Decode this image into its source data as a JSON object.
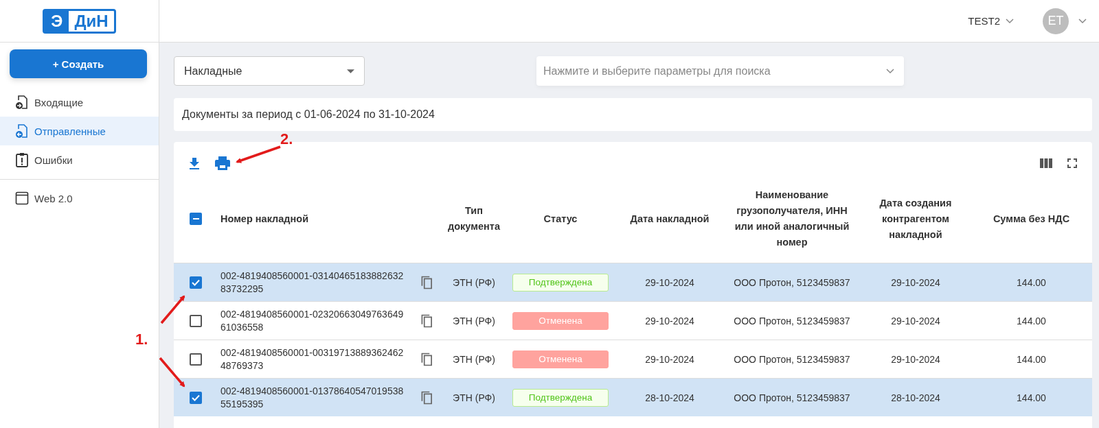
{
  "header": {
    "logo": {
      "left": "Э",
      "right": "ДиН"
    },
    "account": "TEST2",
    "avatar": "ET"
  },
  "sidebar": {
    "create_button": "+ Создать",
    "items": [
      {
        "label": "Входящие",
        "selected": false
      },
      {
        "label": "Отправленные",
        "selected": true
      },
      {
        "label": "Ошибки",
        "selected": false
      }
    ],
    "extra_items": [
      {
        "label": "Web 2.0"
      }
    ]
  },
  "filters": {
    "document_type": "Накладные",
    "search": {
      "placeholder": "Нажмите и выберите параметры для поиска"
    }
  },
  "period": "Документы за период с 01-06-2024 по 31-10-2024",
  "table": {
    "select_all_indeterminate": true,
    "columns": [
      "Номер накладной",
      "Тип документа",
      "Статус",
      "Дата накладной",
      "Наименование грузополучателя, ИНН или иной аналогичный номер",
      "Дата создания контрагентом накладной",
      "Сумма без НДС"
    ],
    "rows": [
      {
        "selected": true,
        "number": "002-4819408560001-0314046518388263283732295",
        "type": "ЭТН (РФ)",
        "status": {
          "label": "Подтверждена",
          "kind": "confirmed"
        },
        "date": "29-10-2024",
        "consignee": "ООО Протон, 5123459837",
        "created": "29-10-2024",
        "sum": "144.00"
      },
      {
        "selected": false,
        "number": "002-4819408560001-0232066304976364961036558",
        "type": "ЭТН (РФ)",
        "status": {
          "label": "Отменена",
          "kind": "cancelled"
        },
        "date": "29-10-2024",
        "consignee": "ООО Протон, 5123459837",
        "created": "29-10-2024",
        "sum": "144.00"
      },
      {
        "selected": false,
        "number": "002-4819408560001-0031971388936246248769373",
        "type": "ЭТН (РФ)",
        "status": {
          "label": "Отменена",
          "kind": "cancelled"
        },
        "date": "29-10-2024",
        "consignee": "ООО Протон, 5123459837",
        "created": "29-10-2024",
        "sum": "144.00"
      },
      {
        "selected": true,
        "number": "002-4819408560001-0137864054701953855195395",
        "type": "ЭТН (РФ)",
        "status": {
          "label": "Подтверждена",
          "kind": "confirmed"
        },
        "date": "28-10-2024",
        "consignee": "ООО Протон, 5123459837",
        "created": "28-10-2024",
        "sum": "144.00"
      }
    ]
  },
  "annotations": [
    {
      "label": "1."
    },
    {
      "label": "2."
    }
  ]
}
